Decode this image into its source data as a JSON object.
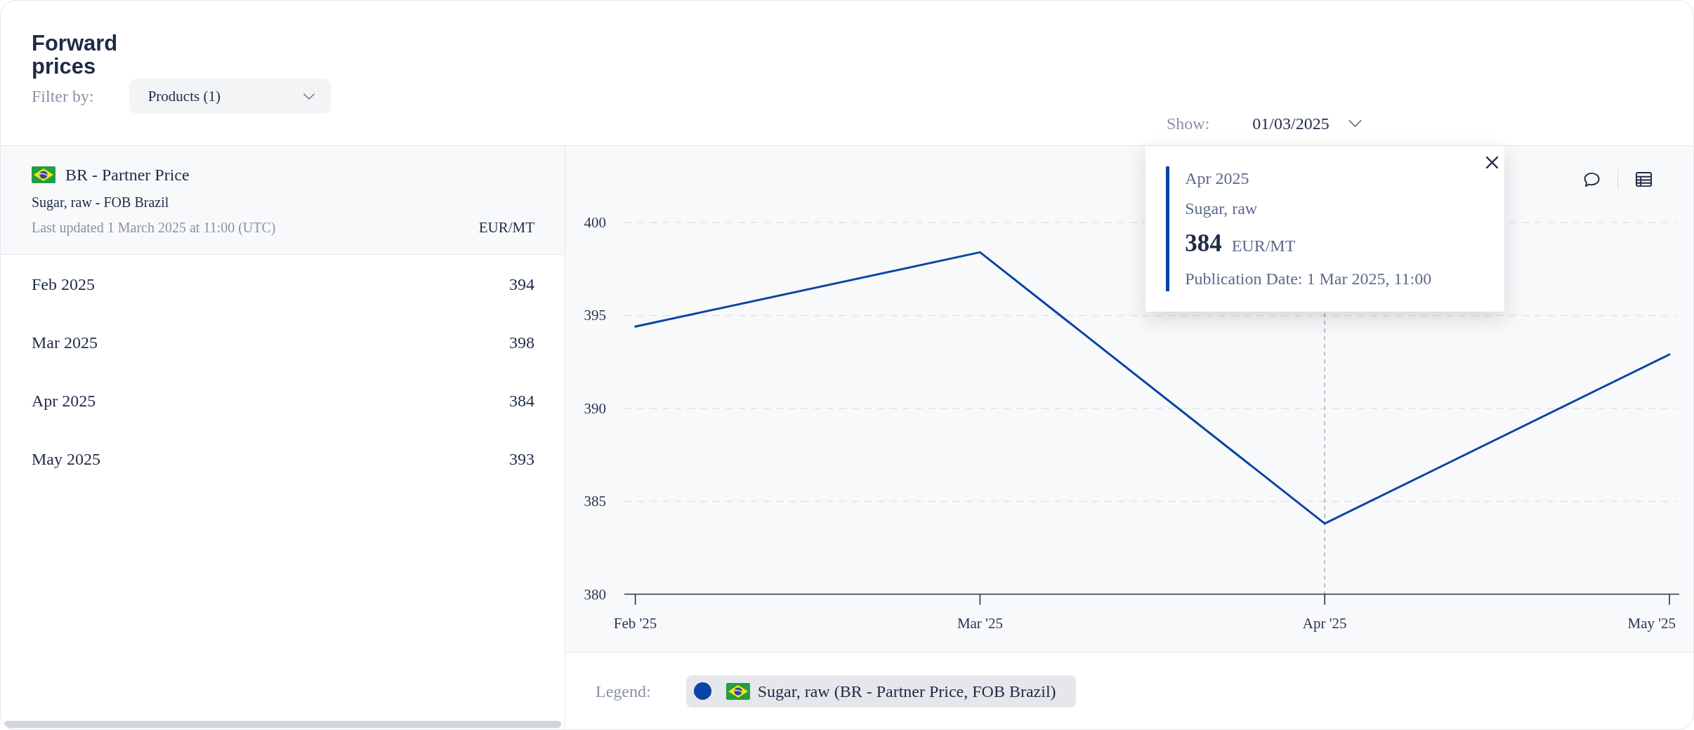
{
  "page": {
    "title": "Forward prices"
  },
  "filter": {
    "label": "Filter by:",
    "dropdown": "Products (1)"
  },
  "show": {
    "label": "Show:",
    "value": "01/03/2025"
  },
  "price_table": {
    "title": "BR - Partner Price",
    "subtitle": "Sugar, raw - FOB Brazil",
    "updated": "Last updated 1 March 2025 at 11:00 (UTC)",
    "unit": "EUR/MT",
    "rows": [
      {
        "period": "Feb 2025",
        "value": "394"
      },
      {
        "period": "Mar 2025",
        "value": "398"
      },
      {
        "period": "Apr 2025",
        "value": "384"
      },
      {
        "period": "May 2025",
        "value": "393"
      }
    ]
  },
  "chart": {
    "chart_data": {
      "type": "line",
      "categories": [
        "Feb '25",
        "Mar '25",
        "Apr '25",
        "May '25"
      ],
      "ylim": [
        380,
        400
      ],
      "yticks": [
        380,
        385,
        390,
        395,
        400
      ],
      "grid": true,
      "series": [
        {
          "name": "Sugar, raw (BR - Partner Price, FOB Brazil)",
          "color": "#0b44a5",
          "values": [
            394.4,
            398.4,
            383.8,
            392.9
          ]
        }
      ],
      "ref_lines": [
        {
          "axis": "x",
          "value": "Apr '25"
        }
      ]
    },
    "tooltip": {
      "period": "Apr 2025",
      "product": "Sugar, raw",
      "value": "384",
      "unit": "EUR/MT",
      "publication": "Publication Date: 1 Mar 2025, 11:00"
    },
    "legend": {
      "label": "Legend:"
    }
  }
}
